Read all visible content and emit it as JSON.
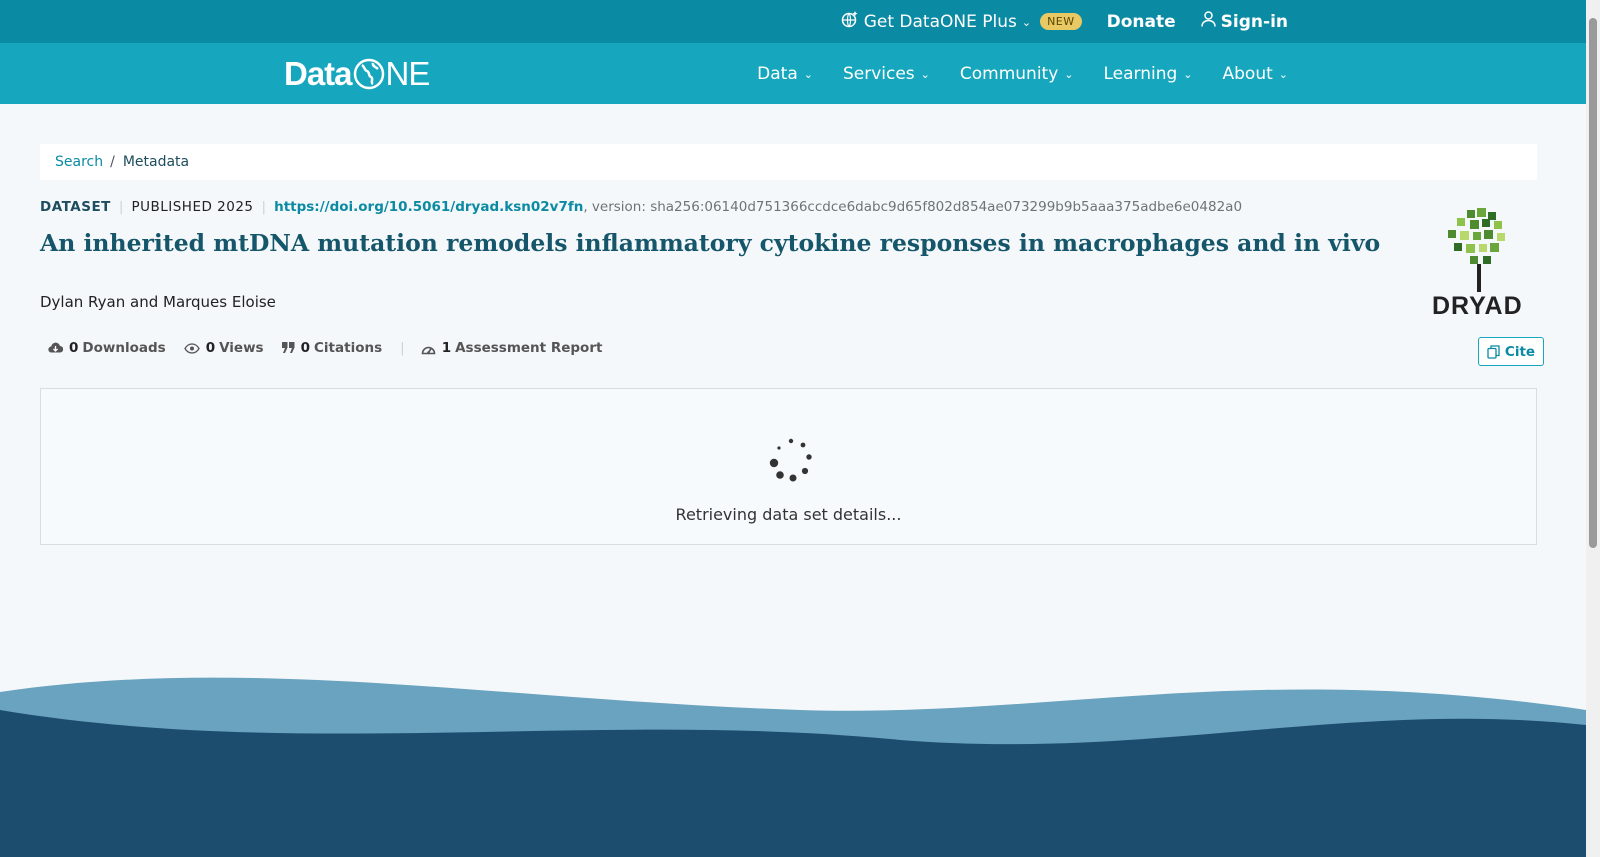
{
  "topbar": {
    "plus_label": "Get DataONE Plus",
    "plus_badge": "NEW",
    "donate_label": "Donate",
    "signin_label": "Sign-in"
  },
  "nav": {
    "logo_data": "Data",
    "logo_one": "NE",
    "items": [
      {
        "label": "Data"
      },
      {
        "label": "Services"
      },
      {
        "label": "Community"
      },
      {
        "label": "Learning"
      },
      {
        "label": "About"
      }
    ]
  },
  "breadcrumb": {
    "search": "Search",
    "separator": "/",
    "current": "Metadata"
  },
  "dataset": {
    "type": "DATASET",
    "published": "PUBLISHED 2025",
    "doi": "https://doi.org/10.5061/dryad.ksn02v7fn",
    "version": ", version: sha256:06140d751366ccdce6dabc9d65f802d854ae073299b9b5aaa375adbe6e0482a0",
    "title": "An inherited mtDNA mutation remodels inflammatory cytokine responses in macrophages and in vivo",
    "authors": "Dylan Ryan and Marques Eloise",
    "repository_label": "DRYAD"
  },
  "metrics": {
    "downloads_count": "0",
    "downloads_label": "Downloads",
    "views_count": "0",
    "views_label": "Views",
    "citations_count": "0",
    "citations_label": "Citations",
    "assessment_count": "1",
    "assessment_label": "Assessment Report"
  },
  "cite_label": "Cite",
  "loading_message": "Retrieving data set details...",
  "colors": {
    "topbar": "#0b8aa3",
    "nav": "#16a7be",
    "title": "#16566a",
    "footer": "#1d4d6e",
    "wave_light": "#6aa3bf"
  }
}
